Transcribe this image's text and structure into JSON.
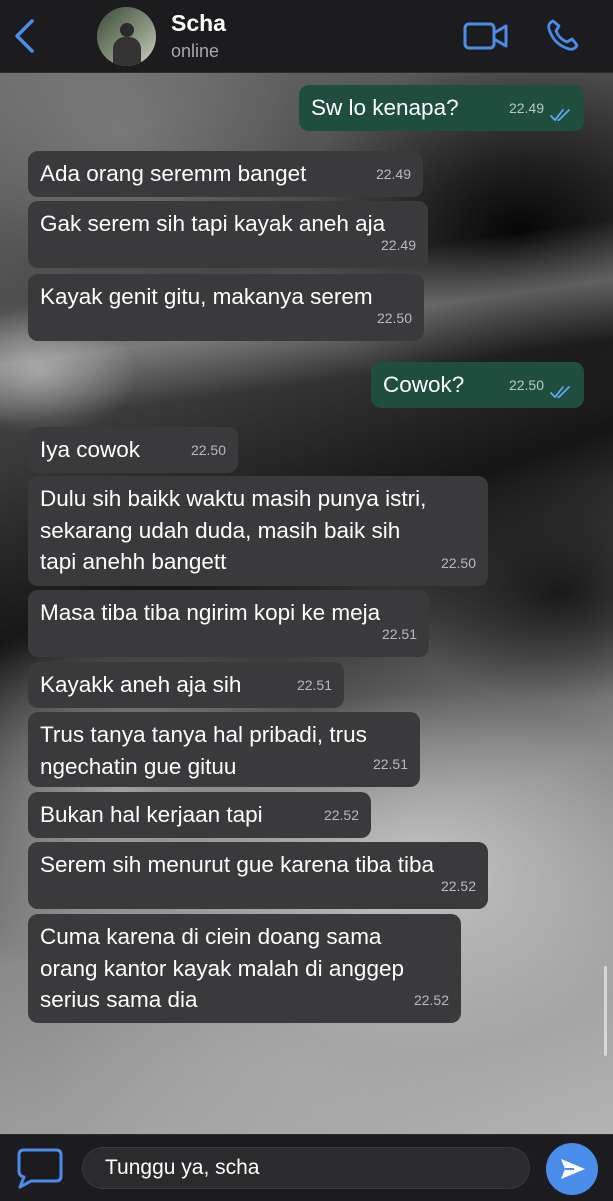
{
  "header": {
    "contact_name": "Scha",
    "status": "online",
    "icons": [
      "back-chevron-icon",
      "video-call-icon",
      "phone-icon"
    ]
  },
  "colors": {
    "accent": "#4a8ce9",
    "sent_bubble": "#1f4e3f",
    "received_bubble": "#3a3a3c",
    "read_ticks": "#5aa7f0"
  },
  "messages": [
    {
      "dir": "sent",
      "text": "Sw lo kenapa?",
      "time": "22.49",
      "read": true
    },
    {
      "dir": "received",
      "text": "Ada orang seremm banget",
      "time": "22.49"
    },
    {
      "dir": "received",
      "text": "Gak serem sih tapi kayak aneh aja",
      "time": "22.49"
    },
    {
      "dir": "received",
      "text": "Kayak genit gitu, makanya serem",
      "time": "22.50"
    },
    {
      "dir": "sent",
      "text": "Cowok?",
      "time": "22.50",
      "read": true
    },
    {
      "dir": "received",
      "text": "Iya cowok",
      "time": "22.50"
    },
    {
      "dir": "received",
      "text": "Dulu sih baikk waktu masih punya istri,\nsekarang udah duda, masih baik sih\ntapi anehh bangett",
      "time": "22.50"
    },
    {
      "dir": "received",
      "text": "Masa tiba tiba ngirim kopi ke meja",
      "time": "22.51"
    },
    {
      "dir": "received",
      "text": "Kayakk aneh aja sih",
      "time": "22.51"
    },
    {
      "dir": "received",
      "text": "Trus tanya tanya hal pribadi, trus\nngechatin gue gituu",
      "time": "22.51"
    },
    {
      "dir": "received",
      "text": "Bukan hal kerjaan tapi",
      "time": "22.52"
    },
    {
      "dir": "received",
      "text": "Serem sih menurut gue karena tiba tiba",
      "time": "22.52"
    },
    {
      "dir": "received",
      "text": "Cuma karena di ciein doang sama\norang kantor kayak malah di anggep\nserius sama dia",
      "time": "22.52"
    }
  ],
  "composer": {
    "draft": "Tunggu ya, scha",
    "icons": [
      "message-bubble-icon",
      "send-arrow-icon"
    ]
  }
}
